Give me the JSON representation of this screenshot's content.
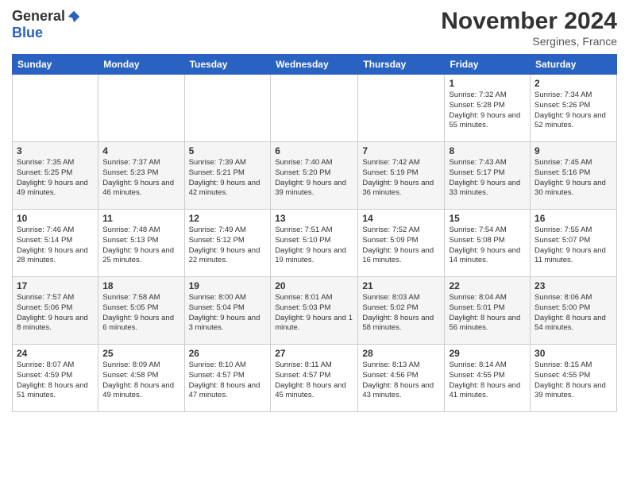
{
  "header": {
    "logo_general": "General",
    "logo_blue": "Blue",
    "month_title": "November 2024",
    "location": "Sergines, France"
  },
  "days_of_week": [
    "Sunday",
    "Monday",
    "Tuesday",
    "Wednesday",
    "Thursday",
    "Friday",
    "Saturday"
  ],
  "weeks": [
    [
      {
        "day": "",
        "sunrise": "",
        "sunset": "",
        "daylight": ""
      },
      {
        "day": "",
        "sunrise": "",
        "sunset": "",
        "daylight": ""
      },
      {
        "day": "",
        "sunrise": "",
        "sunset": "",
        "daylight": ""
      },
      {
        "day": "",
        "sunrise": "",
        "sunset": "",
        "daylight": ""
      },
      {
        "day": "",
        "sunrise": "",
        "sunset": "",
        "daylight": ""
      },
      {
        "day": "1",
        "sunrise": "Sunrise: 7:32 AM",
        "sunset": "Sunset: 5:28 PM",
        "daylight": "Daylight: 9 hours and 55 minutes."
      },
      {
        "day": "2",
        "sunrise": "Sunrise: 7:34 AM",
        "sunset": "Sunset: 5:26 PM",
        "daylight": "Daylight: 9 hours and 52 minutes."
      }
    ],
    [
      {
        "day": "3",
        "sunrise": "Sunrise: 7:35 AM",
        "sunset": "Sunset: 5:25 PM",
        "daylight": "Daylight: 9 hours and 49 minutes."
      },
      {
        "day": "4",
        "sunrise": "Sunrise: 7:37 AM",
        "sunset": "Sunset: 5:23 PM",
        "daylight": "Daylight: 9 hours and 46 minutes."
      },
      {
        "day": "5",
        "sunrise": "Sunrise: 7:39 AM",
        "sunset": "Sunset: 5:21 PM",
        "daylight": "Daylight: 9 hours and 42 minutes."
      },
      {
        "day": "6",
        "sunrise": "Sunrise: 7:40 AM",
        "sunset": "Sunset: 5:20 PM",
        "daylight": "Daylight: 9 hours and 39 minutes."
      },
      {
        "day": "7",
        "sunrise": "Sunrise: 7:42 AM",
        "sunset": "Sunset: 5:19 PM",
        "daylight": "Daylight: 9 hours and 36 minutes."
      },
      {
        "day": "8",
        "sunrise": "Sunrise: 7:43 AM",
        "sunset": "Sunset: 5:17 PM",
        "daylight": "Daylight: 9 hours and 33 minutes."
      },
      {
        "day": "9",
        "sunrise": "Sunrise: 7:45 AM",
        "sunset": "Sunset: 5:16 PM",
        "daylight": "Daylight: 9 hours and 30 minutes."
      }
    ],
    [
      {
        "day": "10",
        "sunrise": "Sunrise: 7:46 AM",
        "sunset": "Sunset: 5:14 PM",
        "daylight": "Daylight: 9 hours and 28 minutes."
      },
      {
        "day": "11",
        "sunrise": "Sunrise: 7:48 AM",
        "sunset": "Sunset: 5:13 PM",
        "daylight": "Daylight: 9 hours and 25 minutes."
      },
      {
        "day": "12",
        "sunrise": "Sunrise: 7:49 AM",
        "sunset": "Sunset: 5:12 PM",
        "daylight": "Daylight: 9 hours and 22 minutes."
      },
      {
        "day": "13",
        "sunrise": "Sunrise: 7:51 AM",
        "sunset": "Sunset: 5:10 PM",
        "daylight": "Daylight: 9 hours and 19 minutes."
      },
      {
        "day": "14",
        "sunrise": "Sunrise: 7:52 AM",
        "sunset": "Sunset: 5:09 PM",
        "daylight": "Daylight: 9 hours and 16 minutes."
      },
      {
        "day": "15",
        "sunrise": "Sunrise: 7:54 AM",
        "sunset": "Sunset: 5:08 PM",
        "daylight": "Daylight: 9 hours and 14 minutes."
      },
      {
        "day": "16",
        "sunrise": "Sunrise: 7:55 AM",
        "sunset": "Sunset: 5:07 PM",
        "daylight": "Daylight: 9 hours and 11 minutes."
      }
    ],
    [
      {
        "day": "17",
        "sunrise": "Sunrise: 7:57 AM",
        "sunset": "Sunset: 5:06 PM",
        "daylight": "Daylight: 9 hours and 8 minutes."
      },
      {
        "day": "18",
        "sunrise": "Sunrise: 7:58 AM",
        "sunset": "Sunset: 5:05 PM",
        "daylight": "Daylight: 9 hours and 6 minutes."
      },
      {
        "day": "19",
        "sunrise": "Sunrise: 8:00 AM",
        "sunset": "Sunset: 5:04 PM",
        "daylight": "Daylight: 9 hours and 3 minutes."
      },
      {
        "day": "20",
        "sunrise": "Sunrise: 8:01 AM",
        "sunset": "Sunset: 5:03 PM",
        "daylight": "Daylight: 9 hours and 1 minute."
      },
      {
        "day": "21",
        "sunrise": "Sunrise: 8:03 AM",
        "sunset": "Sunset: 5:02 PM",
        "daylight": "Daylight: 8 hours and 58 minutes."
      },
      {
        "day": "22",
        "sunrise": "Sunrise: 8:04 AM",
        "sunset": "Sunset: 5:01 PM",
        "daylight": "Daylight: 8 hours and 56 minutes."
      },
      {
        "day": "23",
        "sunrise": "Sunrise: 8:06 AM",
        "sunset": "Sunset: 5:00 PM",
        "daylight": "Daylight: 8 hours and 54 minutes."
      }
    ],
    [
      {
        "day": "24",
        "sunrise": "Sunrise: 8:07 AM",
        "sunset": "Sunset: 4:59 PM",
        "daylight": "Daylight: 8 hours and 51 minutes."
      },
      {
        "day": "25",
        "sunrise": "Sunrise: 8:09 AM",
        "sunset": "Sunset: 4:58 PM",
        "daylight": "Daylight: 8 hours and 49 minutes."
      },
      {
        "day": "26",
        "sunrise": "Sunrise: 8:10 AM",
        "sunset": "Sunset: 4:57 PM",
        "daylight": "Daylight: 8 hours and 47 minutes."
      },
      {
        "day": "27",
        "sunrise": "Sunrise: 8:11 AM",
        "sunset": "Sunset: 4:57 PM",
        "daylight": "Daylight: 8 hours and 45 minutes."
      },
      {
        "day": "28",
        "sunrise": "Sunrise: 8:13 AM",
        "sunset": "Sunset: 4:56 PM",
        "daylight": "Daylight: 8 hours and 43 minutes."
      },
      {
        "day": "29",
        "sunrise": "Sunrise: 8:14 AM",
        "sunset": "Sunset: 4:55 PM",
        "daylight": "Daylight: 8 hours and 41 minutes."
      },
      {
        "day": "30",
        "sunrise": "Sunrise: 8:15 AM",
        "sunset": "Sunset: 4:55 PM",
        "daylight": "Daylight: 8 hours and 39 minutes."
      }
    ]
  ]
}
